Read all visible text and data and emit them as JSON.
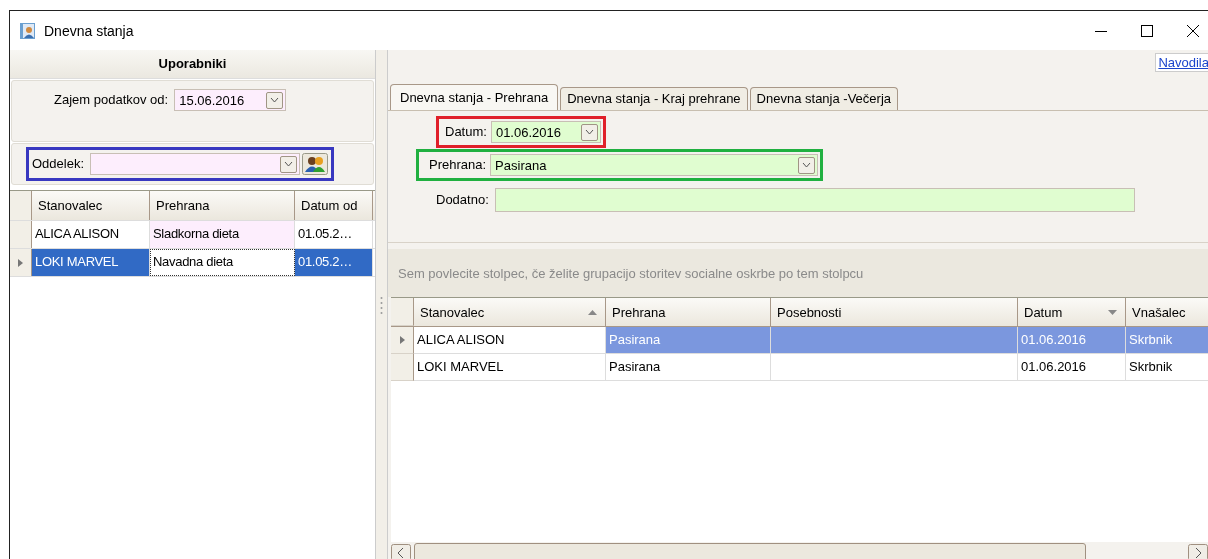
{
  "window": {
    "title": "Dnevna stanja"
  },
  "left_panel": {
    "title": "Uporabniki",
    "date_label": "Zajem podatkov od:",
    "date_value": "15.06.2016",
    "department_label": "Oddelek:",
    "table": {
      "columns": [
        "Stanovalec",
        "Prehrana",
        "Datum od"
      ],
      "rows": [
        {
          "cells": [
            "ALICA ALISON",
            "Sladkorna dieta",
            "01.05.2…"
          ],
          "selected": false
        },
        {
          "cells": [
            "LOKI MARVEL",
            "Navadna dieta",
            "01.05.2…"
          ],
          "selected": true
        }
      ]
    }
  },
  "help_link": "Navodila",
  "tabs": [
    {
      "label": "Dnevna stanja - Prehrana",
      "selected": true
    },
    {
      "label": "Dnevna stanja - Kraj prehrane",
      "selected": false
    },
    {
      "label": "Dnevna stanja -Večerja",
      "selected": false
    }
  ],
  "form": {
    "date_label": "Datum:",
    "date_value": "01.06.2016",
    "diet_label": "Prehrana:",
    "diet_value": "Pasirana",
    "extra_label": "Dodatno:"
  },
  "group_hint": "Sem povlecite stolpec, če želite grupacijo storitev socialne oskrbe po tem stolpcu",
  "grid": {
    "columns": [
      {
        "label": "Stanovalec",
        "sorted": true,
        "descending": false
      },
      {
        "label": "Prehrana",
        "sorted": false
      },
      {
        "label": "Posebnosti",
        "sorted": false
      },
      {
        "label": "Datum",
        "sorted": true,
        "descending": true
      },
      {
        "label": "Vnašalec",
        "sorted": false
      }
    ],
    "rows": [
      {
        "cells": [
          "ALICA ALISON",
          "Pasirana",
          "",
          "01.06.2016",
          "Skrbnik"
        ],
        "selected": true
      },
      {
        "cells": [
          "LOKI MARVEL",
          "Pasirana",
          "",
          "01.06.2016",
          "Skrbnik"
        ],
        "selected": false
      }
    ]
  }
}
